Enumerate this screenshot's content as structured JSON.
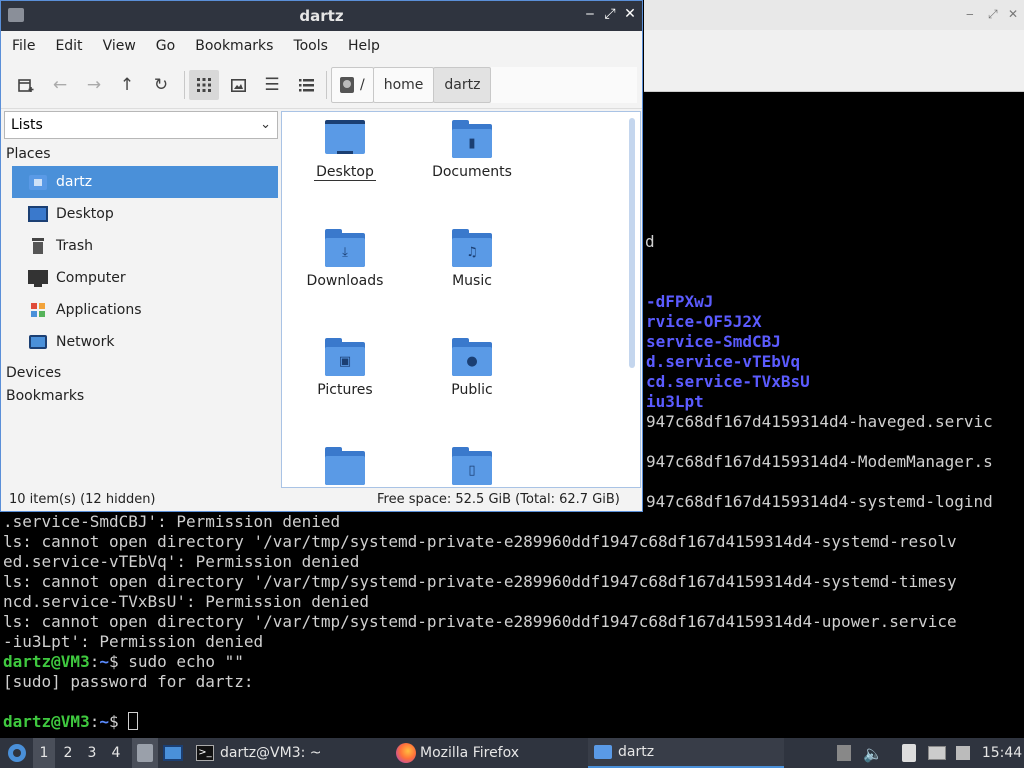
{
  "terminal": {
    "lines_partial": [
      {
        "text": "d",
        "top": 0
      },
      {
        "text": "-dFPXwJ",
        "cls": "blue"
      },
      {
        "text": "rvice-OF5J2X",
        "cls": "blue"
      },
      {
        "text": "service-SmdCBJ",
        "cls": "blue"
      },
      {
        "text": "d.service-vTEbVq",
        "cls": "blue"
      },
      {
        "text": "cd.service-TVxBsU",
        "cls": "blue"
      },
      {
        "text": "iu3Lpt",
        "cls": "blue"
      },
      {
        "text": "947c68df167d4159314d4-haveged.servic"
      },
      {
        "text": "947c68df167d4159314d4-ModemManager.s"
      },
      {
        "text": "947c68df167d4159314d4-systemd-logind"
      }
    ],
    "lines_full": [
      ".service-SmdCBJ': Permission denied",
      "ls: cannot open directory '/var/tmp/systemd-private-e289960ddf1947c68df167d4159314d4-systemd-resolv",
      "ed.service-vTEbVq': Permission denied",
      "ls: cannot open directory '/var/tmp/systemd-private-e289960ddf1947c68df167d4159314d4-systemd-timesy",
      "ncd.service-TVxBsU': Permission denied",
      "ls: cannot open directory '/var/tmp/systemd-private-e289960ddf1947c68df167d4159314d4-upower.service",
      "-iu3Lpt': Permission denied"
    ],
    "prompt_user": "dartz@VM3",
    "prompt_sep": ":",
    "prompt_path": "~",
    "prompt_symbol": "$",
    "command1": " sudo echo \"\"",
    "sudo_prompt": "[sudo] password for dartz:",
    "command2": " "
  },
  "file_manager": {
    "title": "dartz",
    "controls": {
      "minimize": "‒",
      "maximize": "⤢",
      "close": "✕"
    },
    "menu": [
      "File",
      "Edit",
      "View",
      "Go",
      "Bookmarks",
      "Tools",
      "Help"
    ],
    "toolbar_icons": [
      "new-tab-icon",
      "back-icon",
      "forward-icon",
      "up-icon",
      "reload-icon",
      "icon-view-icon",
      "thumbnail-view-icon",
      "compact-view-icon",
      "detailed-list-icon"
    ],
    "path": {
      "root": "/",
      "crumbs": [
        "home",
        "dartz"
      ]
    },
    "side_pane": {
      "mode": "Lists",
      "places_header": "Places",
      "places": [
        "dartz",
        "Desktop",
        "Trash",
        "Computer",
        "Applications",
        "Network"
      ],
      "devices_header": "Devices",
      "bookmarks_header": "Bookmarks"
    },
    "items": [
      {
        "name": "Desktop",
        "icon": "desktop-folder-icon"
      },
      {
        "name": "Documents",
        "icon": "documents-folder-icon"
      },
      {
        "name": "Downloads",
        "icon": "downloads-folder-icon"
      },
      {
        "name": "Music",
        "icon": "music-folder-icon"
      },
      {
        "name": "Pictures",
        "icon": "pictures-folder-icon"
      },
      {
        "name": "Public",
        "icon": "public-folder-icon"
      },
      {
        "name": "",
        "icon": "folder-icon"
      },
      {
        "name": "",
        "icon": "templates-folder-icon"
      }
    ],
    "status_left": "10 item(s) (12 hidden)",
    "status_right": "Free space: 52.5 GiB (Total: 62.7 GiB)"
  },
  "taskbar": {
    "workspaces": [
      "1",
      "2",
      "3",
      "4"
    ],
    "tasks": [
      {
        "label": "dartz@VM3: ~",
        "icon": "terminal-icon"
      },
      {
        "label": "Mozilla Firefox",
        "icon": "firefox-icon"
      },
      {
        "label": "dartz",
        "icon": "folder-icon"
      }
    ],
    "clock": "15:44"
  },
  "colors": {
    "accent": "#4a90d9",
    "panel": "#2f343f",
    "terminal_green": "#3fc93f",
    "terminal_blue": "#5b5bff"
  }
}
